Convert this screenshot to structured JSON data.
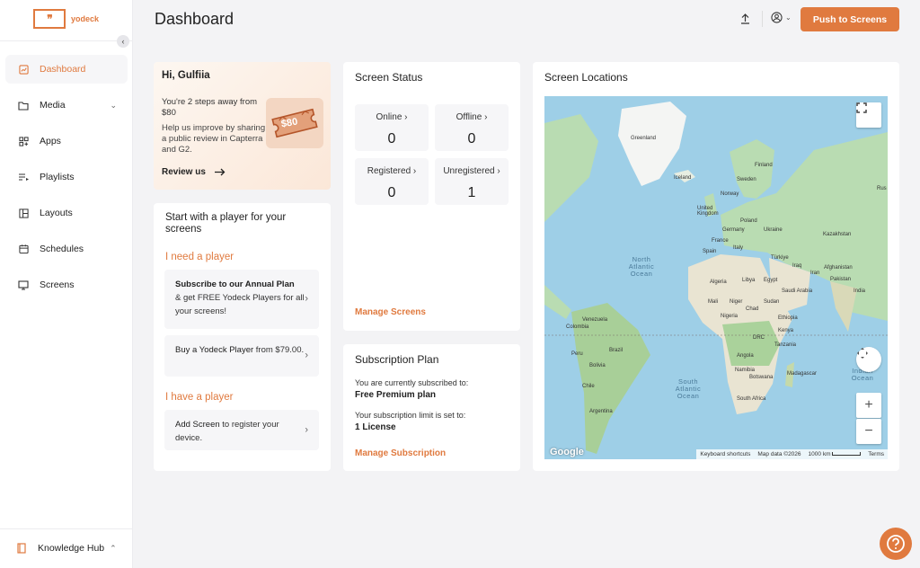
{
  "brand": {
    "logo_mark": "❞",
    "name": "yodeck"
  },
  "sidebar": {
    "items": [
      {
        "label": "Dashboard",
        "icon": "chart-icon"
      },
      {
        "label": "Media",
        "icon": "folder-icon"
      },
      {
        "label": "Apps",
        "icon": "apps-icon"
      },
      {
        "label": "Playlists",
        "icon": "playlist-icon"
      },
      {
        "label": "Layouts",
        "icon": "layout-icon"
      },
      {
        "label": "Schedules",
        "icon": "calendar-icon"
      },
      {
        "label": "Screens",
        "icon": "monitor-icon"
      }
    ],
    "knowledge_hub": "Knowledge Hub"
  },
  "header": {
    "title": "Dashboard",
    "push_button": "Push to Screens"
  },
  "promo": {
    "greeting": "Hi, Gulfiia",
    "steps": "You're 2 steps away from $80",
    "description": "Help us improve by sharing a public review in Capterra and G2.",
    "review_link": "Review us",
    "ticket_value": "$80"
  },
  "player": {
    "title": "Start with a player for your screens",
    "need_heading": "I need a player",
    "annual_bold": "Subscribe to our Annual Plan",
    "annual_rest": "& get FREE Yodeck Players for all your screens!",
    "buy_bold": "Buy a Yodeck Player",
    "buy_rest": "from $79.00.",
    "have_heading": "I have a player",
    "add_bold": "Add Screen",
    "add_rest": "to register your device."
  },
  "status": {
    "title": "Screen Status",
    "cells": [
      {
        "label": "Online",
        "value": "0"
      },
      {
        "label": "Offline",
        "value": "0"
      },
      {
        "label": "Registered",
        "value": "0"
      },
      {
        "label": "Unregistered",
        "value": "1"
      }
    ],
    "manage": "Manage Screens"
  },
  "subscription": {
    "title": "Subscription Plan",
    "subscribed_label": "You are currently subscribed to:",
    "plan": "Free Premium plan",
    "limit_label": "Your subscription limit is set to:",
    "limit": "1 License",
    "manage": "Manage Subscription"
  },
  "locations": {
    "title": "Screen Locations",
    "google": "Google",
    "footer": {
      "shortcuts": "Keyboard shortcuts",
      "data": "Map data ©2026",
      "scale": "1000 km",
      "terms": "Terms"
    },
    "ocean_labels": [
      "North Atlantic Ocean",
      "South Atlantic Ocean",
      "Indian Ocean"
    ],
    "place_labels": [
      "Greenland",
      "Iceland",
      "Finland",
      "Sweden",
      "Norway",
      "United Kingdom",
      "Poland",
      "Germany",
      "Ukraine",
      "France",
      "Italy",
      "Spain",
      "Kazakhstan",
      "Türkiye",
      "Iraq",
      "Iran",
      "Afghanistan",
      "Pakistan",
      "India",
      "Algeria",
      "Libya",
      "Egypt",
      "Saudi Arabia",
      "Mali",
      "Niger",
      "Chad",
      "Sudan",
      "Nigeria",
      "Ethiopia",
      "DRC",
      "Kenya",
      "Tanzania",
      "Angola",
      "Namibia",
      "Botswana",
      "Madagascar",
      "South Africa",
      "Venezuela",
      "Colombia",
      "Brazil",
      "Peru",
      "Bolivia",
      "Chile",
      "Argentina",
      "Rus"
    ]
  }
}
